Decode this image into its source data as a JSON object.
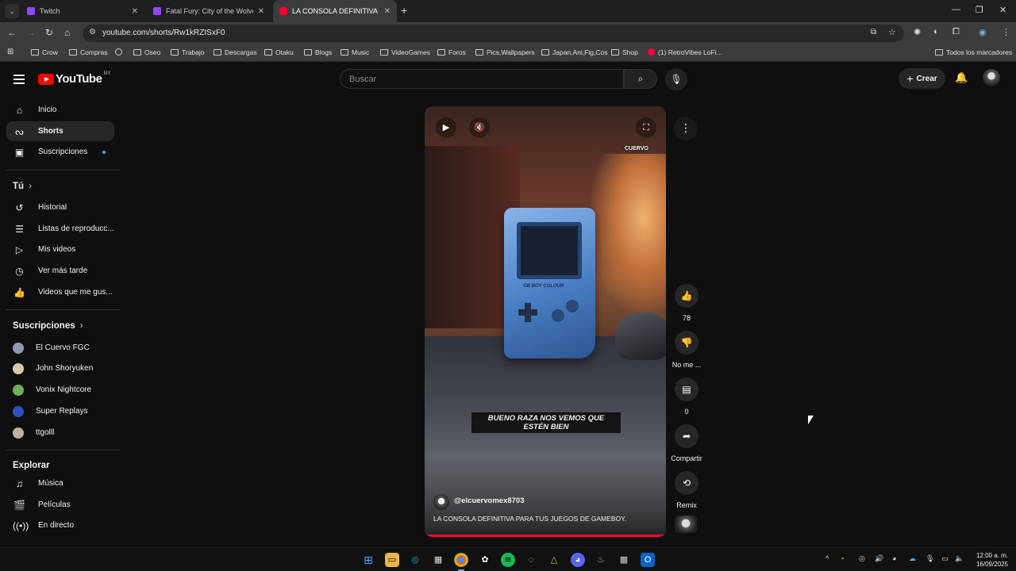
{
  "browser": {
    "tabs": [
      {
        "title": "Twitch",
        "favicon_color": "#9146ff"
      },
      {
        "title": "Fatal Fury: City of the Wolves -",
        "favicon_color": "#9146ff"
      },
      {
        "title": "LA CONSOLA DEFINITIVA PARA",
        "favicon_color": "#ff0033"
      }
    ],
    "url": "youtube.com/shorts/Rw1kRZISxF0",
    "bookmarks": [
      "Crow",
      "Compras",
      "Oseo",
      "Trabajo",
      "Descargas",
      "Otaku",
      "Blogs",
      "Music",
      "VideoGames",
      "Foros",
      "Pics,Wallpapers",
      "Japan,Ani,Fig,Cos",
      "Shop",
      "(1) RetroVibes LoFi..."
    ],
    "all_bookmarks": "Todos los marcadores"
  },
  "youtube": {
    "logo_text": "YouTube",
    "country_code": "MX",
    "search_placeholder": "Buscar",
    "create_label": "Crear",
    "sidebar": {
      "main": [
        {
          "label": "Inicio",
          "icon": "home-icon"
        },
        {
          "label": "Shorts",
          "icon": "shorts-icon"
        },
        {
          "label": "Suscripciones",
          "icon": "subscriptions-icon"
        }
      ],
      "you_header": "Tú",
      "you": [
        {
          "label": "Historial",
          "icon": "history-icon"
        },
        {
          "label": "Listas de reproducc...",
          "icon": "playlist-icon"
        },
        {
          "label": "Mis videos",
          "icon": "my-videos-icon"
        },
        {
          "label": "Ver más tarde",
          "icon": "watch-later-icon"
        },
        {
          "label": "Videos que me gus...",
          "icon": "liked-icon"
        }
      ],
      "subs_header": "Suscripciones",
      "subs": [
        {
          "label": "El Cuervo FGC",
          "color": "#8a9ab5"
        },
        {
          "label": "John Shoryuken",
          "color": "#d8c9a8"
        },
        {
          "label": "Vonix Nightcore",
          "color": "#6fae5a"
        },
        {
          "label": "Super Replays",
          "color": "#3050c0"
        },
        {
          "label": "ttgolll",
          "color": "#c0b0a0"
        }
      ],
      "explore_header": "Explorar",
      "explore": [
        {
          "label": "Música",
          "icon": "music-icon"
        },
        {
          "label": "Películas",
          "icon": "movies-icon"
        },
        {
          "label": "En directo",
          "icon": "live-icon"
        }
      ]
    },
    "short": {
      "caption": "BUENO RAZA NOS VEMOS QUE ESTÉN BIEN",
      "watermark": "CUERVO",
      "device_label": "GB BOY COLOUR",
      "channel_handle": "@elcuervomex8703",
      "title": "LA CONSOLA DEFINITIVA PARA TUS JUEGOS DE GAMEBOY.",
      "progress": 1.0
    },
    "actions": {
      "likes": "78",
      "dislike": "No me ...",
      "comments": "0",
      "share": "Compartir",
      "remix": "Remix"
    }
  },
  "taskbar": {
    "time": "12:00 a. m.",
    "date": "16/09/2025"
  }
}
